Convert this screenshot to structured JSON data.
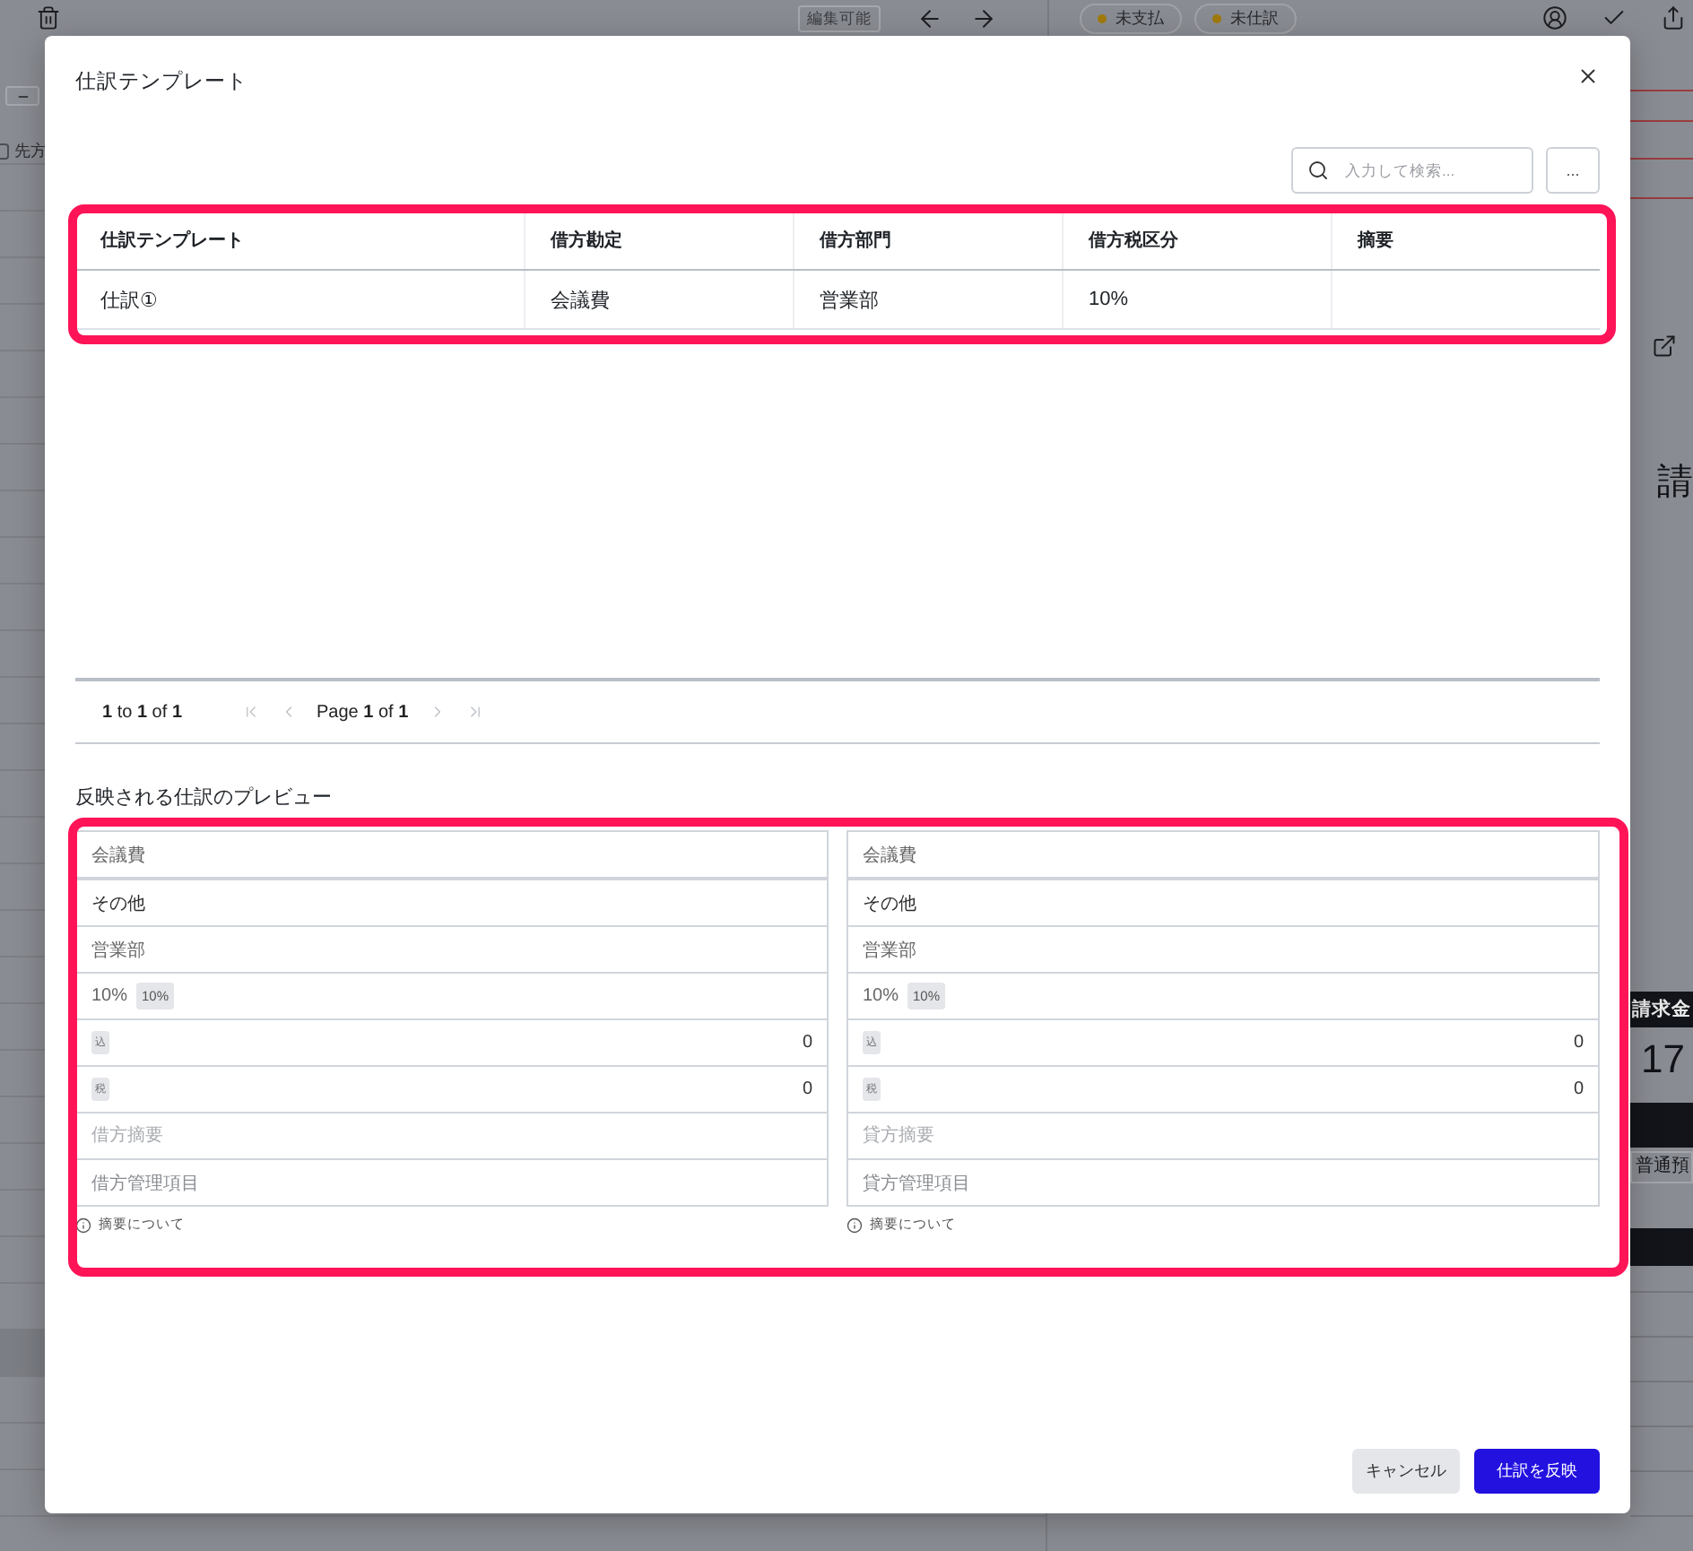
{
  "background": {
    "toolbar": {
      "badge": "編集可能",
      "chips": [
        "未支払",
        "未仕訳"
      ]
    },
    "list": {
      "filter": {
        "label": "先方",
        "checked": false
      }
    },
    "detail": {
      "heading": "請",
      "amount_label": "請求金",
      "amount": "17",
      "account": "普通預"
    }
  },
  "dialog": {
    "title": "仕訳テンプレート",
    "search": {
      "placeholder": "入力して検索..."
    },
    "more_button": "...",
    "table": {
      "highlighted": true,
      "columns": [
        "仕訳テンプレート",
        "借方勘定",
        "借方部門",
        "借方税区分",
        "摘要"
      ],
      "rows": [
        {
          "cells": [
            "仕訳①",
            "会議費",
            "営業部",
            "10%"
          ]
        }
      ]
    },
    "pagination": {
      "summary": "**1** to **1** of **1**",
      "page": "Page **1** of **1**",
      "buttons": [
        {
          "kind": "first",
          "disabled": true
        },
        {
          "kind": "previous",
          "disabled": true
        },
        {
          "kind": "next",
          "disabled": true
        },
        {
          "kind": "last",
          "disabled": true
        }
      ]
    },
    "preview": {
      "title": "反映される仕訳のプレビュー",
      "highlighted": true,
      "sides": [
        {
          "rows": [
            {
              "kind": "select",
              "value": "会議費"
            },
            {
              "kind": "label",
              "value": "その他"
            },
            {
              "kind": "select",
              "value": "営業部"
            },
            {
              "kind": "tax",
              "value": "10%",
              "badge": "10%"
            },
            {
              "kind": "amount",
              "badge": "込",
              "value": "0"
            },
            {
              "kind": "amount",
              "badge": "税",
              "value": "0"
            },
            {
              "kind": "input",
              "placeholder": "借方摘要"
            },
            {
              "kind": "select",
              "placeholder": "借方管理項目"
            }
          ],
          "note": "摘要について"
        },
        {
          "rows": [
            {
              "kind": "select",
              "value": "会議費"
            },
            {
              "kind": "label",
              "value": "その他"
            },
            {
              "kind": "select",
              "value": "営業部"
            },
            {
              "kind": "tax",
              "value": "10%",
              "badge": "10%"
            },
            {
              "kind": "amount",
              "badge": "込",
              "value": "0"
            },
            {
              "kind": "amount",
              "badge": "税",
              "value": "0"
            },
            {
              "kind": "input",
              "placeholder": "貸方摘要"
            },
            {
              "kind": "select",
              "placeholder": "貸方管理項目"
            }
          ],
          "note": "摘要について"
        }
      ]
    },
    "buttons": [
      {
        "kind": "secondary",
        "label": "キャンセル"
      },
      {
        "kind": "primary",
        "label": "仕訳を反映"
      }
    ]
  }
}
